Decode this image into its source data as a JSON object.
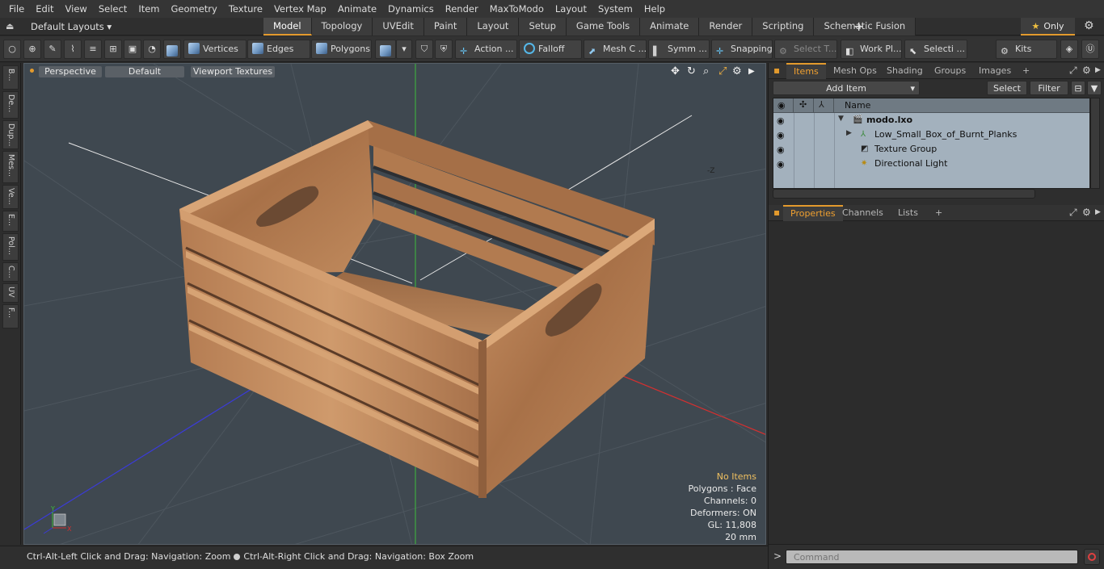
{
  "menu": [
    "File",
    "Edit",
    "View",
    "Select",
    "Item",
    "Geometry",
    "Texture",
    "Vertex Map",
    "Animate",
    "Dynamics",
    "Render",
    "MaxToModo",
    "Layout",
    "System",
    "Help"
  ],
  "layouts": {
    "label": "Default Layouts ▾"
  },
  "tabs": [
    "Model",
    "Topology",
    "UVEdit",
    "Paint",
    "Layout",
    "Setup",
    "Game Tools",
    "Animate",
    "Render",
    "Scripting",
    "Schematic Fusion"
  ],
  "active_tab": "Model",
  "tab_add": "+",
  "only_label": "Only",
  "toolbar": {
    "vertices": "Vertices",
    "edges": "Edges",
    "polygons": "Polygons",
    "action": "Action ...",
    "falloff": "Falloff",
    "mesh": "Mesh C ...",
    "symm": "Symm ...",
    "snapping": "Snapping",
    "select_t": "Select T...",
    "workpl": "Work Pl...",
    "selecti": "Selecti ...",
    "kits": "Kits"
  },
  "left_tabs": [
    "B...",
    "De...",
    "Dup...",
    "Mes...",
    "Ve...",
    "E...",
    "Pol...",
    "C...",
    "UV",
    "F..."
  ],
  "viewport": {
    "perspective": "Perspective",
    "default": "Default",
    "textures": "Viewport Textures",
    "info": {
      "no_items": "No Items",
      "polygons": "Polygons : Face",
      "channels": "Channels: 0",
      "deformers": "Deformers: ON",
      "gl": "GL: 11,808",
      "scale": "20 mm"
    }
  },
  "status": {
    "hint_left": "Ctrl-Alt-Left Click and Drag: Navigation: Zoom",
    "hint_right": "Ctrl-Alt-Right Click and Drag: Navigation: Box Zoom"
  },
  "items_panel": {
    "tabs": [
      "Items",
      "Mesh Ops",
      "Shading",
      "Groups",
      "Images"
    ],
    "add_item": "Add Item",
    "select": "Select",
    "filter": "Filter",
    "column_name": "Name",
    "rows": [
      {
        "label": "modo.lxo",
        "bold": true
      },
      {
        "label": "Low_Small_Box_of_Burnt_Planks",
        "bold": false
      },
      {
        "label": "Texture Group",
        "bold": false
      },
      {
        "label": "Directional Light",
        "bold": false
      }
    ]
  },
  "properties_panel": {
    "tabs": [
      "Properties",
      "Channels",
      "Lists"
    ]
  },
  "command": {
    "placeholder": "Command",
    "prompt": ">"
  },
  "colors": {
    "accent": "#e39a2d",
    "viewport_bg": "#3f4850",
    "items_bg": "#a3b1bd",
    "wood": "#b07a4f"
  }
}
